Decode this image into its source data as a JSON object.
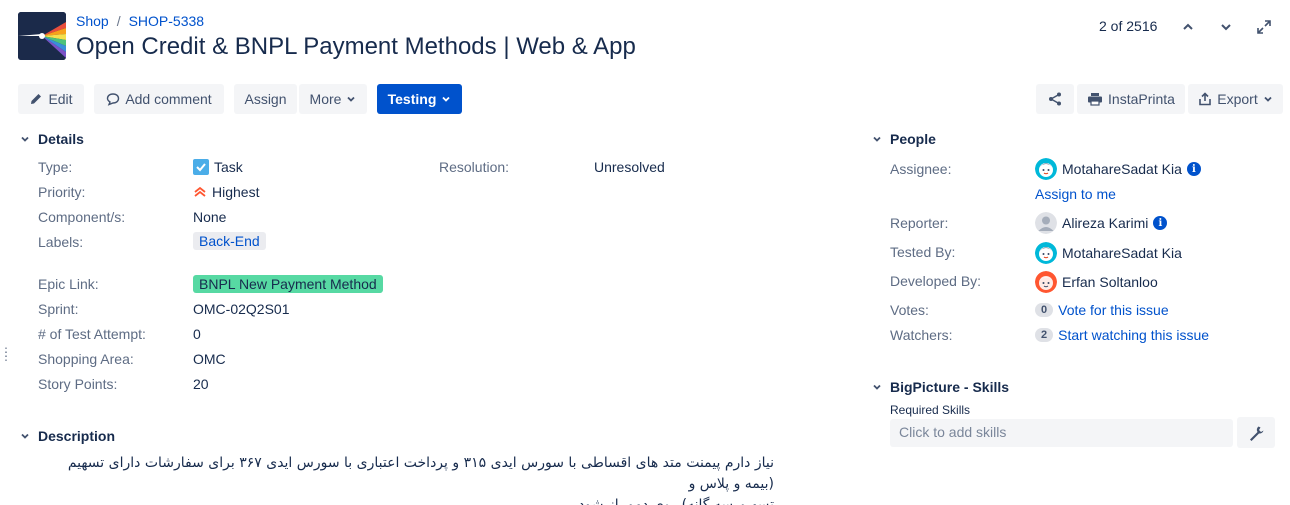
{
  "breadcrumb": {
    "project": "Shop",
    "separator": "/",
    "issue_key": "SHOP-5338"
  },
  "title": "Open Credit & BNPL Payment Methods | Web & App",
  "pager": {
    "label": "2 of 2516"
  },
  "toolbar": {
    "edit": "Edit",
    "add_comment": "Add comment",
    "assign": "Assign",
    "more": "More",
    "status": "Testing",
    "instaprinta": "InstaPrinta",
    "export": "Export"
  },
  "details": {
    "heading": "Details",
    "type_label": "Type:",
    "type_value": "Task",
    "priority_label": "Priority:",
    "priority_value": "Highest",
    "component_label": "Component/s:",
    "component_value": "None",
    "labels_label": "Labels:",
    "labels_value": "Back-End",
    "resolution_label": "Resolution:",
    "resolution_value": "Unresolved",
    "epic_label": "Epic Link:",
    "epic_value": "BNPL New Payment Method",
    "sprint_label": "Sprint:",
    "sprint_value": "OMC-02Q2S01",
    "test_attempt_label": "# of Test Attempt:",
    "test_attempt_value": "0",
    "shopping_area_label": "Shopping Area:",
    "shopping_area_value": "OMC",
    "story_points_label": "Story Points:",
    "story_points_value": "20"
  },
  "description": {
    "heading": "Description",
    "line1": "نیاز دارم پیمنت متد های اقساطی با سورس ایدی ۳۱۵ و پرداخت اعتباری با سورس ایدی ۳۶۷ برای سفارشات دارای تسهیم (بیمه و پلاس و",
    "line2": "تسهیم سه گانه) روی دمو باز شود."
  },
  "people": {
    "heading": "People",
    "assignee_label": "Assignee:",
    "assignee_value": "MotahareSadat Kia",
    "assign_to_me": "Assign to me",
    "reporter_label": "Reporter:",
    "reporter_value": "Alireza Karimi",
    "tested_by_label": "Tested By:",
    "tested_by_value": "MotahareSadat Kia",
    "developed_by_label": "Developed By:",
    "developed_by_value": "Erfan Soltanloo",
    "votes_label": "Votes:",
    "votes_count": "0",
    "votes_link": "Vote for this issue",
    "watchers_label": "Watchers:",
    "watchers_count": "2",
    "watchers_link": "Start watching this issue"
  },
  "bigpicture": {
    "heading": "BigPicture - Skills",
    "required_label": "Required Skills",
    "placeholder": "Click to add skills"
  },
  "colors": {
    "primary": "#0052cc",
    "epic": "#57d9a3",
    "text": "#172b4d",
    "muted": "#5e6c84"
  }
}
